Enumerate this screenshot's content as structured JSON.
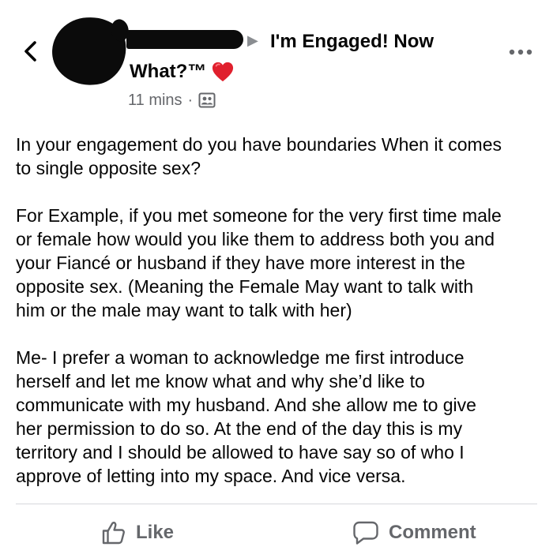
{
  "post": {
    "group_name_line1": "I'm Engaged! Now",
    "group_name_line2": "What?™",
    "group_arrow": "▶",
    "time": "11 mins",
    "separator": "·",
    "body_paragraphs": [
      "In your engagement do you have boundaries When it comes\nto single opposite sex?",
      "For Example, if you met someone for the very first time male\nor female how would you like them to address both you and\nyour Fiancé or husband if they have more interest in the\nopposite sex. (Meaning the Female May want to talk with\nhim or the male may want to talk with her)",
      "Me- I prefer a woman to acknowledge me first introduce\nherself and let me know what and why she’d like to\ncommunicate with my husband. And she allow me to give\nher permission to do so. At the end of the day this is my\nterritory and I should be allowed to have say so of who I\napprove of letting into my space.  And vice versa."
    ]
  },
  "actions": {
    "like_label": "Like",
    "comment_label": "Comment"
  },
  "icons": {
    "back": "chevron-left-icon",
    "more": "more-horizontal-icon",
    "heart": "red-heart-icon",
    "audience": "members-icon",
    "like": "thumbs-up-icon",
    "comment": "comment-bubble-icon"
  },
  "colors": {
    "text": "#050505",
    "secondary_text": "#65676b",
    "heart": "#e0202d"
  }
}
